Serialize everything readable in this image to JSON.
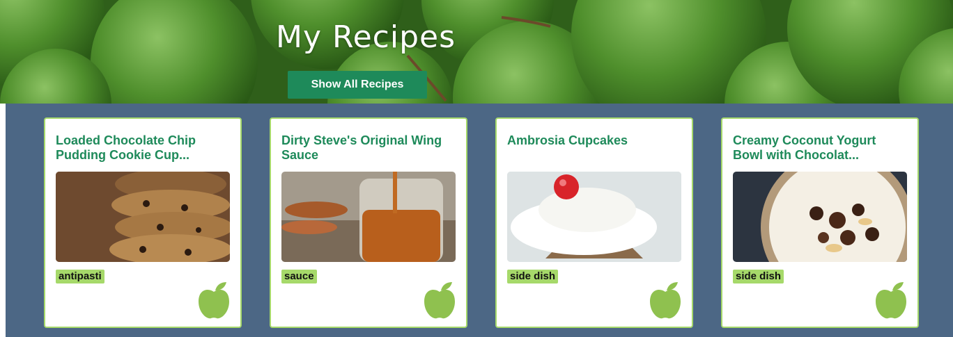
{
  "hero": {
    "title": "My Recipes",
    "show_all_label": "Show All Recipes"
  },
  "colors": {
    "accent": "#1e8a5a",
    "tag": "#a6d96a",
    "background": "#4c6785"
  },
  "recipes": [
    {
      "title": "Loaded Chocolate Chip Pudding Cookie Cup...",
      "tag": "antipasti",
      "image": "stacked-cookies",
      "icon": "apple-icon"
    },
    {
      "title": "Dirty Steve's Original Wing Sauce",
      "tag": "sauce",
      "image": "sauce-jar",
      "icon": "apple-icon"
    },
    {
      "title": "Ambrosia Cupcakes",
      "tag": "side dish",
      "image": "coconut-cupcake",
      "icon": "apple-icon"
    },
    {
      "title": "Creamy Coconut Yogurt Bowl with Chocolat...",
      "tag": "side dish",
      "image": "yogurt-bowl",
      "icon": "apple-icon"
    }
  ]
}
